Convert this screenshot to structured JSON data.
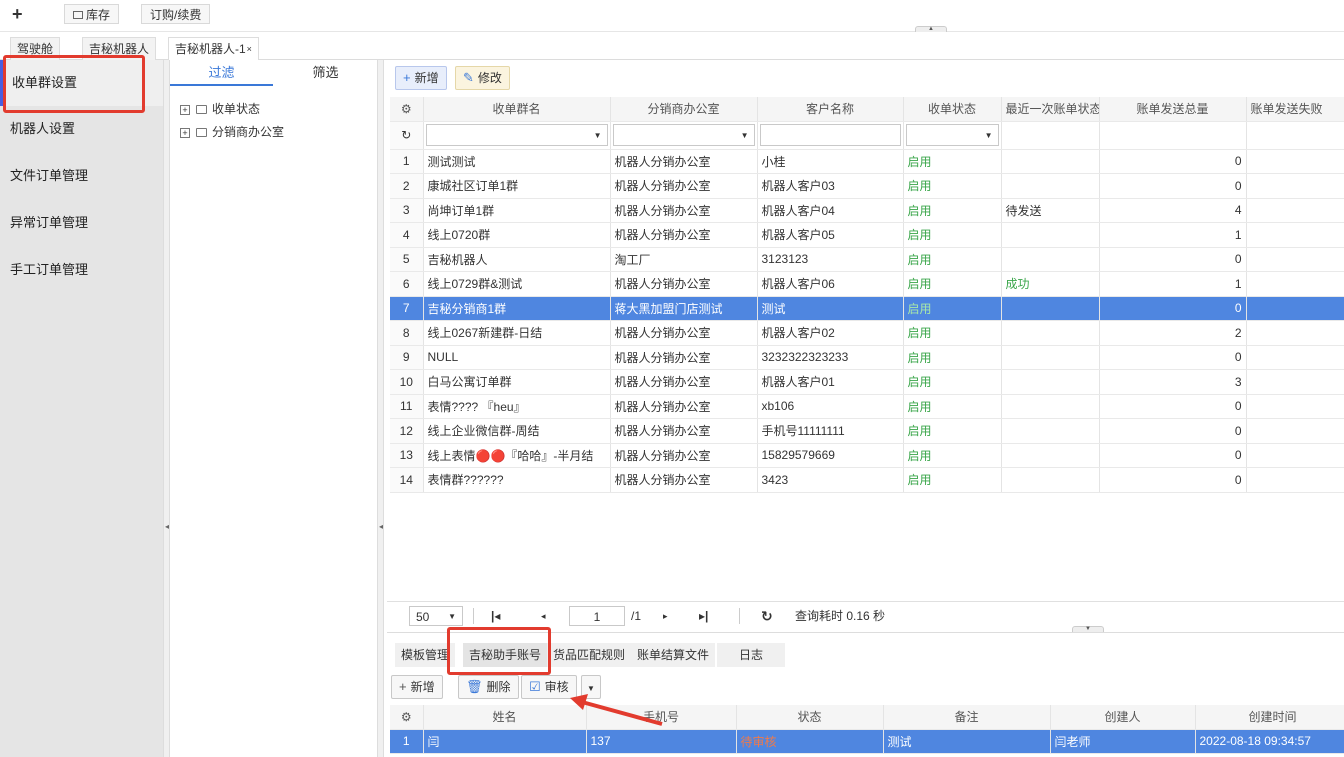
{
  "topbar": {
    "add_label": "+",
    "buttons": [
      "库存",
      "订购/续费"
    ]
  },
  "tabs": [
    {
      "label": "驾驶舱"
    },
    {
      "label": "吉秘机器人"
    },
    {
      "label": "吉秘机器人-1",
      "close": "×"
    }
  ],
  "nav": {
    "items": [
      "收单群设置",
      "机器人设置",
      "文件订单管理",
      "异常订单管理",
      "手工订单管理"
    ]
  },
  "filter": {
    "tabs": [
      "过滤",
      "筛选"
    ],
    "tree": [
      "收单状态",
      "分销商办公室"
    ]
  },
  "toolbar": {
    "add_label": "新增",
    "edit_label": "修改"
  },
  "grid": {
    "columns": [
      "收单群名",
      "分销商办公室",
      "客户名称",
      "收单状态",
      "最近一次账单状态",
      "账单发送总量",
      "账单发送失败"
    ],
    "rows": [
      {
        "n": "1",
        "name": "测试测试",
        "office": "机器人分销办公室",
        "customer": "小桂",
        "status": "启用",
        "last": "",
        "total": "0"
      },
      {
        "n": "2",
        "name": "康城社区订单1群",
        "office": "机器人分销办公室",
        "customer": "机器人客户03",
        "status": "启用",
        "last": "",
        "total": "0"
      },
      {
        "n": "3",
        "name": "尚坤订单1群",
        "office": "机器人分销办公室",
        "customer": "机器人客户04",
        "status": "启用",
        "last": "待发送",
        "total": "4"
      },
      {
        "n": "4",
        "name": "线上0720群",
        "office": "机器人分销办公室",
        "customer": "机器人客户05",
        "status": "启用",
        "last": "",
        "total": "1"
      },
      {
        "n": "5",
        "name": "吉秘机器人",
        "office": "淘工厂",
        "customer": "3123123",
        "status": "启用",
        "last": "",
        "total": "0"
      },
      {
        "n": "6",
        "name": "线上0729群&测试",
        "office": "机器人分销办公室",
        "customer": "机器人客户06",
        "status": "启用",
        "last": "成功",
        "total": "1"
      },
      {
        "n": "7",
        "name": "吉秘分销商1群",
        "office": "蒋大黑加盟门店测试",
        "customer": "测试",
        "status": "启用",
        "last": "",
        "total": "0"
      },
      {
        "n": "8",
        "name": "线上0267新建群-日结",
        "office": "机器人分销办公室",
        "customer": "机器人客户02",
        "status": "启用",
        "last": "",
        "total": "2"
      },
      {
        "n": "9",
        "name": "NULL",
        "office": "机器人分销办公室",
        "customer": "3232322323233",
        "status": "启用",
        "last": "",
        "total": "0"
      },
      {
        "n": "10",
        "name": "白马公寓订单群",
        "office": "机器人分销办公室",
        "customer": "机器人客户01",
        "status": "启用",
        "last": "",
        "total": "3"
      },
      {
        "n": "11",
        "name": "表情???? 『heu』",
        "office": "机器人分销办公室",
        "customer": "xb106",
        "status": "启用",
        "last": "",
        "total": "0"
      },
      {
        "n": "12",
        "name": "线上企业微信群-周结",
        "office": "机器人分销办公室",
        "customer": "手机号11111111",
        "status": "启用",
        "last": "",
        "total": "0"
      },
      {
        "n": "13",
        "name": "线上表情🔴🔴『哈哈』-半月结",
        "office": "机器人分销办公室",
        "customer": "15829579669",
        "status": "启用",
        "last": "",
        "total": "0"
      },
      {
        "n": "14",
        "name": "表情群??????",
        "office": "机器人分销办公室",
        "customer": "3423",
        "status": "启用",
        "last": "",
        "total": "0"
      }
    ]
  },
  "pager": {
    "page_size": "50",
    "page": "1",
    "total_pages": "/1",
    "timing": "查询耗时 0.16 秒"
  },
  "bottom": {
    "tabs": [
      "模板管理",
      "吉秘助手账号",
      "货品匹配规则",
      "账单结算文件",
      "日志"
    ],
    "toolbar": {
      "add": "新增",
      "delete": "删除",
      "audit": "审核"
    },
    "columns": [
      "姓名",
      "手机号",
      "状态",
      "备注",
      "创建人",
      "创建时间"
    ],
    "rows": [
      {
        "n": "1",
        "name": "闫",
        "phone": "137",
        "status": "待审核",
        "note": "测试",
        "creator": "闫老师",
        "created": "2022-08-18 09:34:57"
      }
    ]
  }
}
